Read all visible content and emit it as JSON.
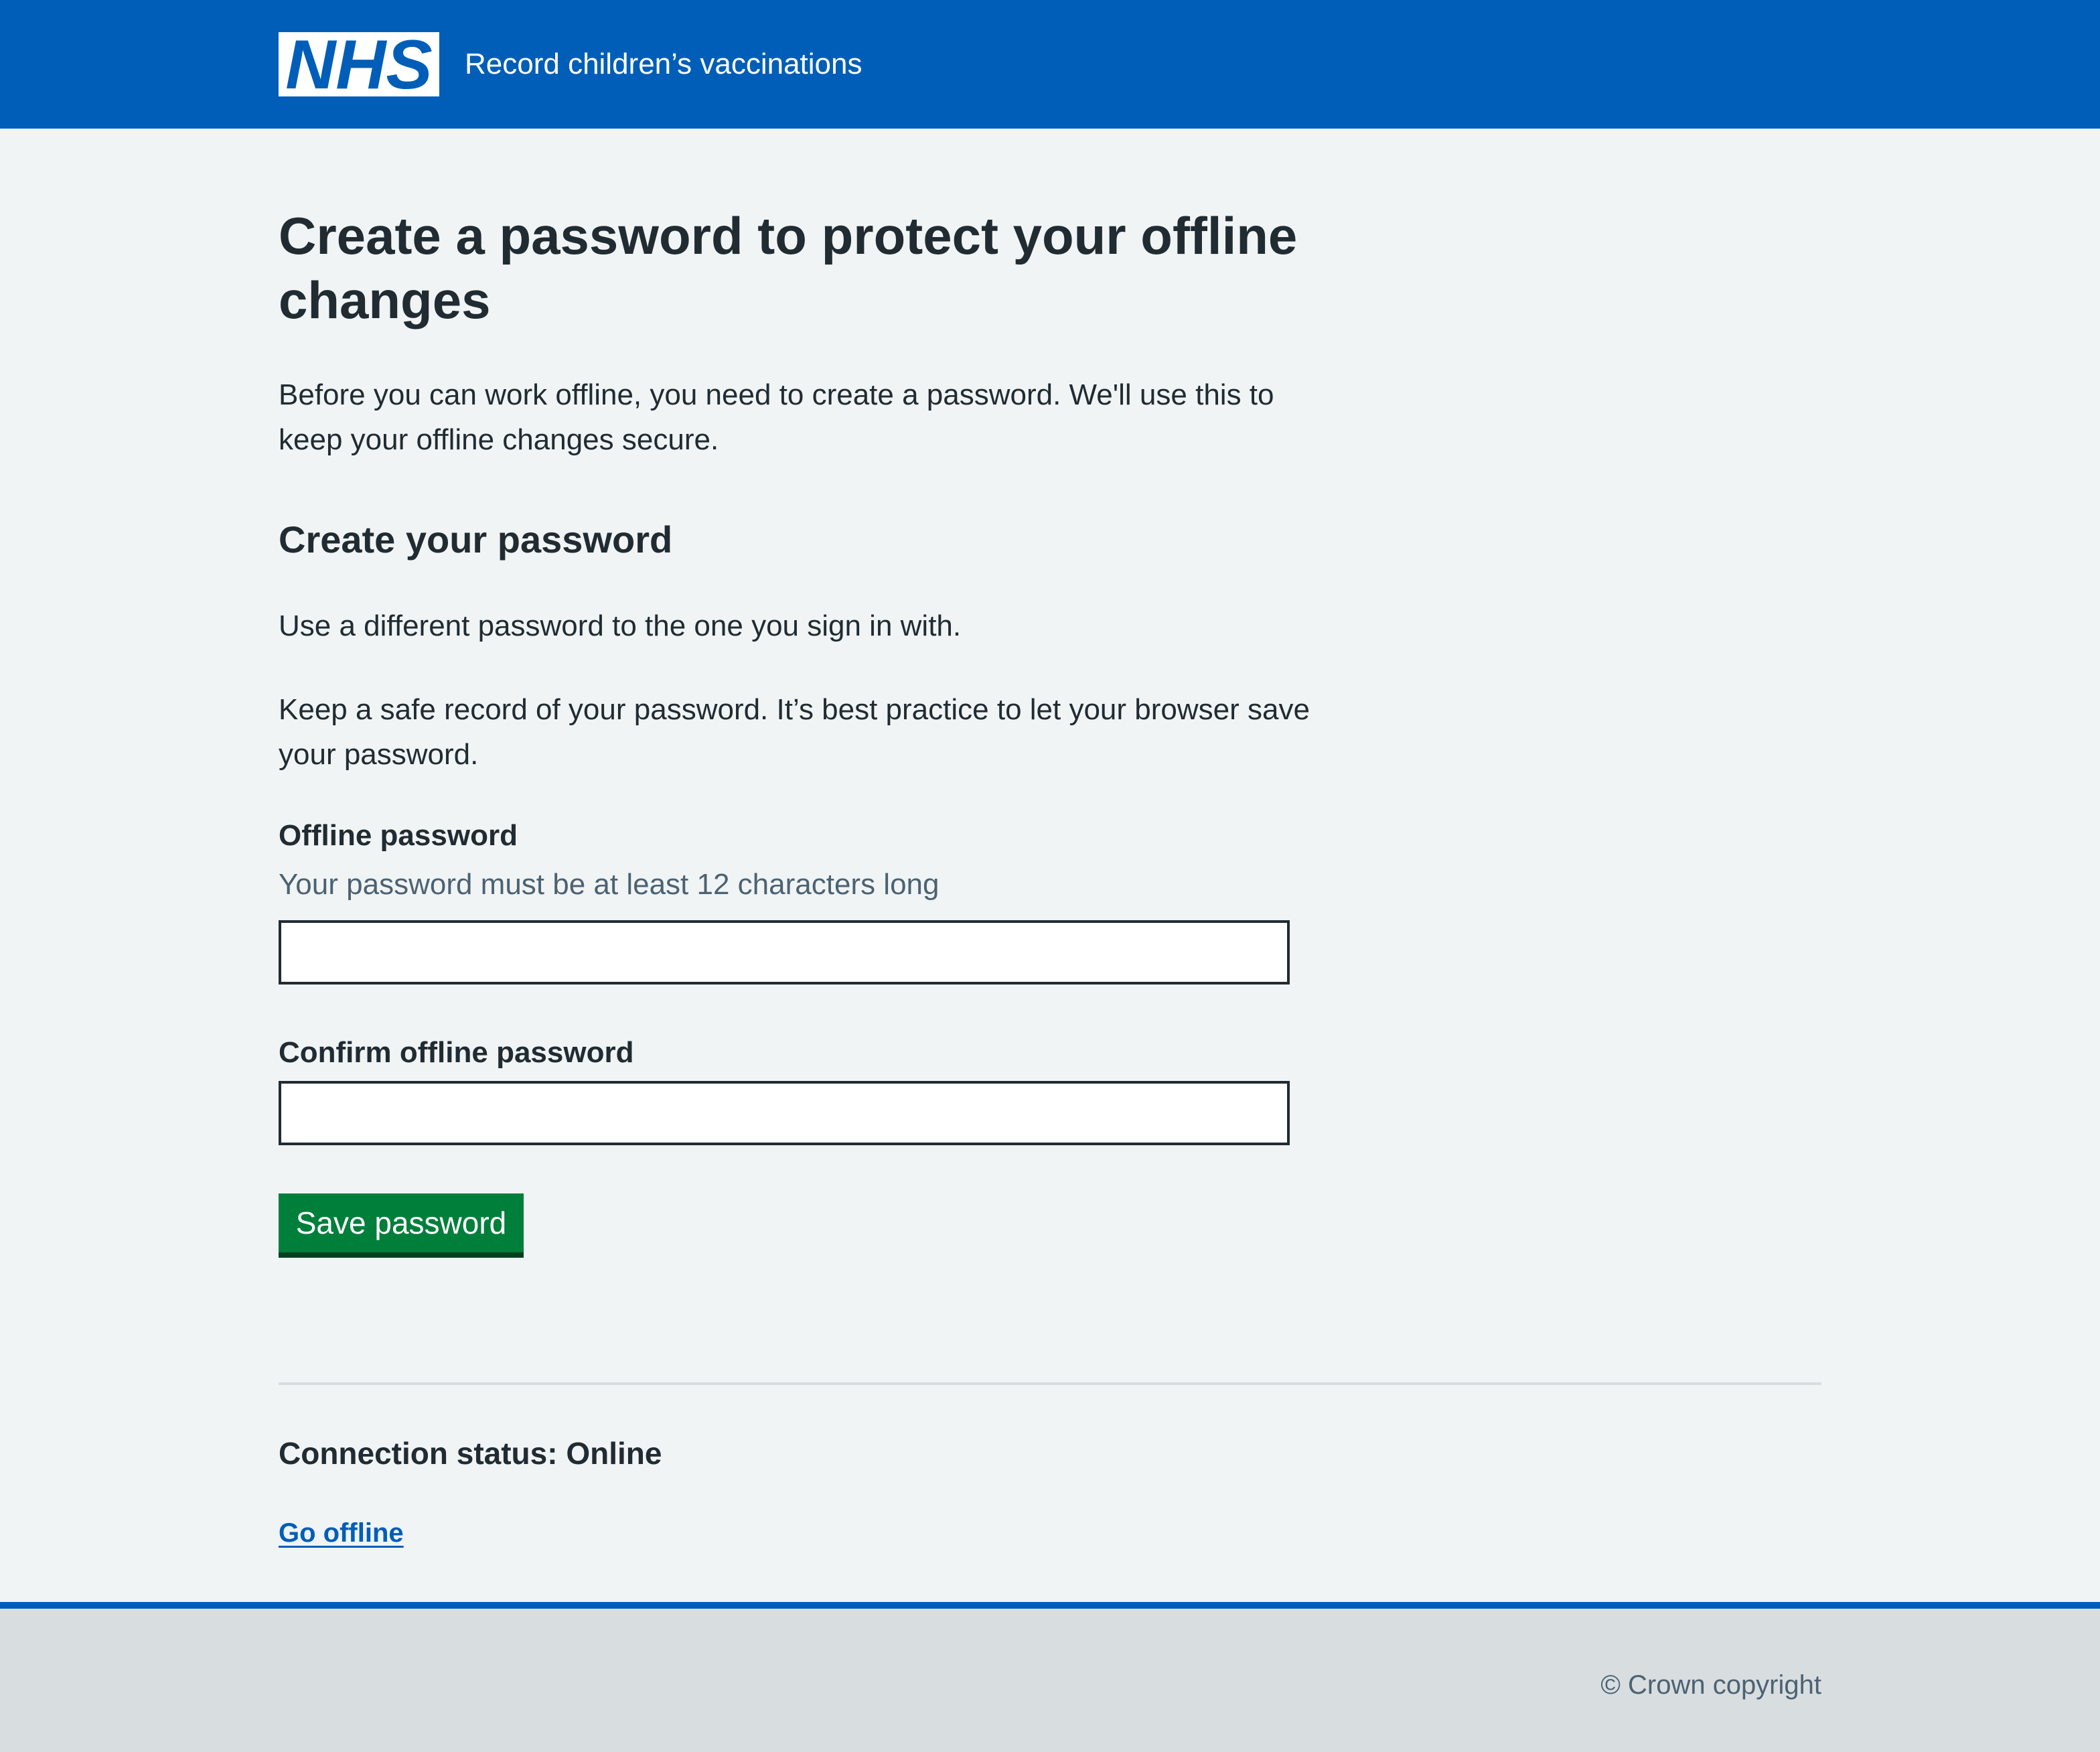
{
  "header": {
    "logo_text": "NHS",
    "service_name": "Record children’s vaccinations",
    "brand_color": "#005eb8"
  },
  "main": {
    "title": "Create a password to protect your offline changes",
    "intro": "Before you can work offline, you need to create a password. We'll use this to keep your offline changes secure.",
    "section_title": "Create your password",
    "paragraph_different": "Use a different password to the one you sign in with.",
    "paragraph_keep": "Keep a safe record of your password. It’s best practice to let your browser save your password.",
    "form": {
      "password_label": "Offline password",
      "password_hint": "Your password must be at least 12 characters long",
      "password_value": "",
      "confirm_label": "Confirm offline password",
      "confirm_value": "",
      "submit_label": "Save password",
      "submit_color": "#007f3b"
    },
    "connection": {
      "status_label": "Connection status:",
      "status_value": "Online",
      "action_label": "Go offline"
    }
  },
  "footer": {
    "copyright": "© Crown copyright"
  }
}
